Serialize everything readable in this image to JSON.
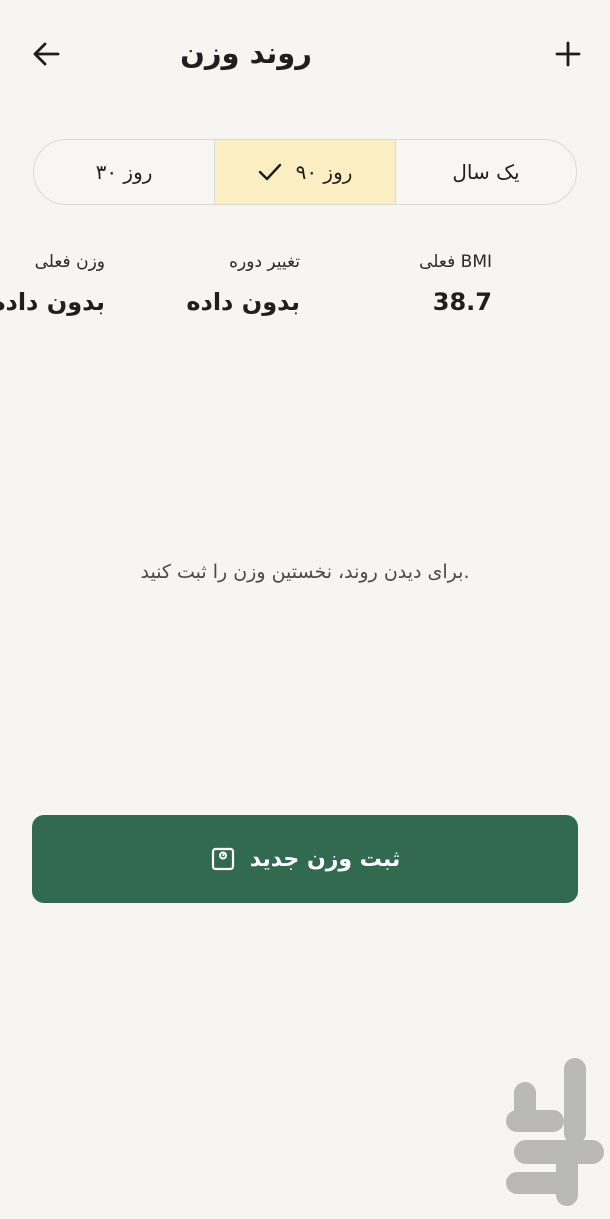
{
  "header": {
    "title": "روند وزن",
    "back_icon": "arrow-left-icon",
    "add_icon": "plus-icon"
  },
  "range_tabs": {
    "items": [
      {
        "label": "روز ۳۰",
        "selected": false
      },
      {
        "label": "روز ۹۰",
        "selected": true
      },
      {
        "label": "یک سال",
        "selected": false
      }
    ],
    "selected_color": "#fbeec2"
  },
  "stats": {
    "current_weight": {
      "label": "وزن فعلی",
      "value": "بدون داده"
    },
    "period_change": {
      "label": "تغییر دوره",
      "value": "بدون داده"
    },
    "bmi": {
      "label": "BMI فعلی",
      "value": "38.7"
    }
  },
  "empty_state": {
    "message": ".برای دیدن روند، نخستین وزن را ثبت کنید"
  },
  "actions": {
    "add_weight_label": "ثبت وزن جدید",
    "add_weight_icon": "scale-icon",
    "button_color": "#326a51"
  },
  "watermark": {
    "logo": "store-logo"
  }
}
